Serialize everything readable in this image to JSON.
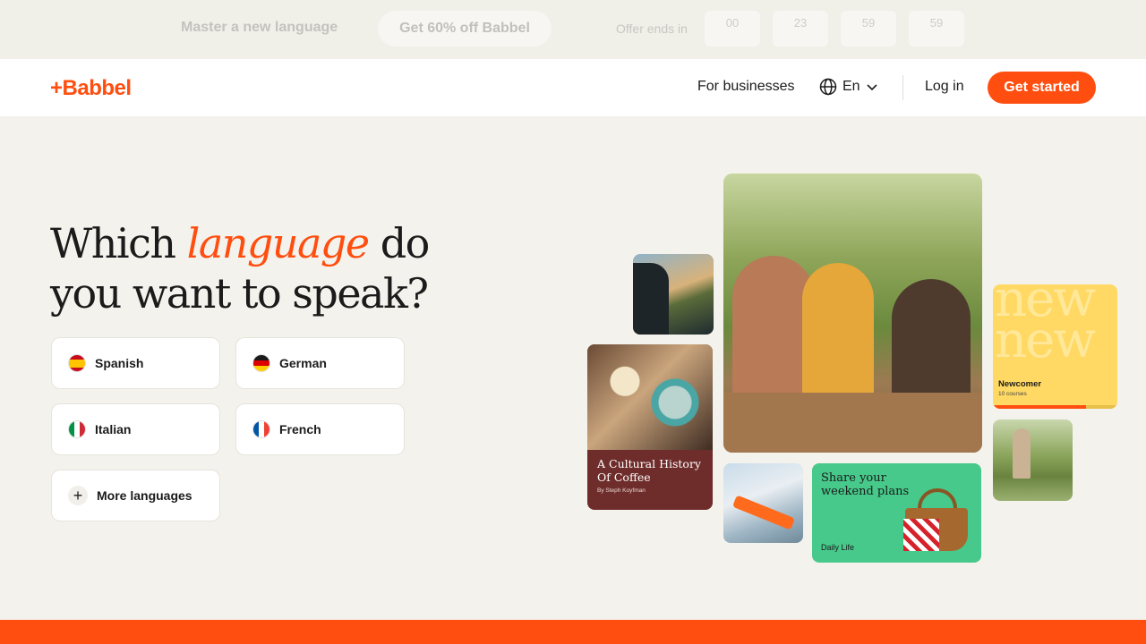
{
  "promo": {
    "text": "Master a new language",
    "button": "Get 60% off Babbel",
    "label": "Offer ends in",
    "countdown": [
      "00",
      "23",
      "59",
      "59"
    ]
  },
  "header": {
    "logo": "+Babbel",
    "for_businesses": "For businesses",
    "language": "En",
    "login": "Log in",
    "cta": "Get started"
  },
  "hero": {
    "title_before": "Which ",
    "title_accent": "language",
    "title_after": " do you want to speak?",
    "languages": [
      {
        "name": "Spanish",
        "flag": "spain-flag-icon"
      },
      {
        "name": "German",
        "flag": "germany-flag-icon"
      },
      {
        "name": "Italian",
        "flag": "italy-flag-icon"
      },
      {
        "name": "French",
        "flag": "france-flag-icon"
      }
    ],
    "more": "More languages"
  },
  "collage": {
    "coffee_title": "A Cultural History Of Coffee",
    "coffee_author": "By Steph Koyfman",
    "newcomer_bg": "new new",
    "newcomer_label": "Newcomer",
    "newcomer_count": "10 courses",
    "newcomer_progress": 0.75,
    "green_title": "Share your weekend plans",
    "green_category": "Daily Life"
  },
  "colors": {
    "brand": "#ff4e0f",
    "background": "#f3f2ec"
  }
}
